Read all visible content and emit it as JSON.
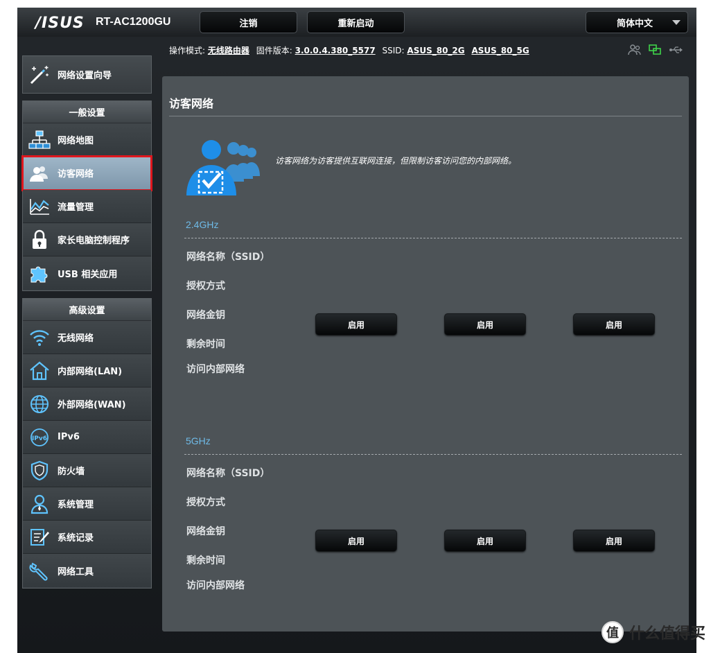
{
  "header": {
    "brand": "/ISUS",
    "model": "RT-AC1200GU",
    "logout_label": "注销",
    "reboot_label": "重新启动",
    "language_label": "简体中文"
  },
  "infobar": {
    "mode_label": "操作模式:",
    "mode_value": "无线路由器",
    "firmware_label": "固件版本:",
    "firmware_value": "3.0.0.4.380_5577",
    "ssid_label": "SSID:",
    "ssid_2g": "ASUS_80_2G",
    "ssid_5g": "ASUS_80_5G"
  },
  "sidebar": {
    "wizard_label": "网络设置向导",
    "general": {
      "title": "一般设置",
      "items": [
        {
          "label": "网络地图",
          "icon": "network-map-icon"
        },
        {
          "label": "访客网络",
          "icon": "guest-network-icon"
        },
        {
          "label": "流量管理",
          "icon": "traffic-manager-icon"
        },
        {
          "label": "家长电脑控制程序",
          "icon": "parental-lock-icon"
        },
        {
          "label": "USB 相关应用",
          "icon": "usb-puzzle-icon"
        }
      ]
    },
    "advanced": {
      "title": "高级设置",
      "items": [
        {
          "label": "无线网络",
          "icon": "wifi-icon"
        },
        {
          "label": "内部网络(LAN)",
          "icon": "home-icon"
        },
        {
          "label": "外部网络(WAN)",
          "icon": "globe-icon"
        },
        {
          "label": "IPv6",
          "icon": "ipv6-icon"
        },
        {
          "label": "防火墙",
          "icon": "shield-icon"
        },
        {
          "label": "系统管理",
          "icon": "admin-user-icon"
        },
        {
          "label": "系统记录",
          "icon": "log-edit-icon"
        },
        {
          "label": "网络工具",
          "icon": "tools-icon"
        }
      ]
    },
    "active_item": "访客网络"
  },
  "main": {
    "title": "访客网络",
    "description": "访客网络为访客提供互联网连接，但限制访客访问您的内部网络。",
    "bands": [
      {
        "name": "2.4GHz",
        "rows": [
          "网络名称（SSID）",
          "授权方式",
          "网络金钥",
          "剩余时间",
          "访问内部网络"
        ],
        "buttons": [
          "启用",
          "启用",
          "启用"
        ]
      },
      {
        "name": "5GHz",
        "rows": [
          "网络名称（SSID）",
          "授权方式",
          "网络金钥",
          "剩余时间",
          "访问内部网络"
        ],
        "buttons": [
          "启用",
          "启用",
          "启用"
        ]
      }
    ]
  },
  "watermark": {
    "badge": "值",
    "text": "什么值得买"
  },
  "colors": {
    "accent_blue": "#6fbbe8",
    "active_highlight": "#e0161d",
    "panel_bg": "#4d5357"
  }
}
